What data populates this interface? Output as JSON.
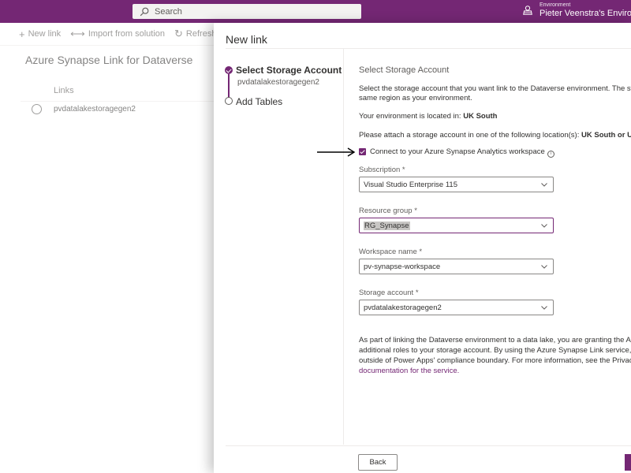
{
  "topbar": {
    "search_placeholder": "Search",
    "environment_label": "Environment",
    "environment_name": "Pieter Veenstra's Enviro..."
  },
  "commandbar": {
    "new_link": "New link",
    "import": "Import from solution",
    "refresh": "Refresh"
  },
  "page": {
    "title": "Azure Synapse Link for Dataverse",
    "column_header": "Links",
    "rows": [
      "pvdatalakestoragegen2"
    ]
  },
  "panel": {
    "title": "New link",
    "steps": [
      {
        "label": "Select Storage Account",
        "sub": "pvdatalakestoragegen2",
        "state": "current"
      },
      {
        "label": "Add Tables",
        "state": "pending"
      }
    ],
    "section_title": "Select Storage Account",
    "intro_line1": "Select the storage account that you want link to the Dataverse environment. The storage ac",
    "intro_line2": "same region as your environment.",
    "env_location_prefix": "Your environment is located in:",
    "env_location": "UK South",
    "attach_prefix": "Please attach a storage account in one of the following location(s):",
    "attach_locations": "UK South or UK West",
    "checkbox_label": "Connect to your Azure Synapse Analytics workspace",
    "checkbox_checked": true,
    "info_glyph": "i",
    "fields": {
      "subscription": {
        "label": "Subscription *",
        "value": "Visual Studio Enterprise 115"
      },
      "resource_group": {
        "label": "Resource group *",
        "value": "RG_Synapse"
      },
      "workspace": {
        "label": "Workspace name *",
        "value": "pv-synapse-workspace"
      },
      "storage": {
        "label": "Storage account *",
        "value": "pvdatalakestoragegen2"
      }
    },
    "disclaimer_line1": "As part of linking the Dataverse environment to a data lake, you are granting the Azure Syn",
    "disclaimer_line2": "additional roles to your storage account. By using the Azure Synapse Link service, you agre",
    "disclaimer_line3": "outside of Power Apps' compliance boundary. For more information, see the Privacy Notice",
    "disclaimer_link": "documentation for the service.",
    "back_label": "Back"
  },
  "colors": {
    "brand": "#742774"
  }
}
